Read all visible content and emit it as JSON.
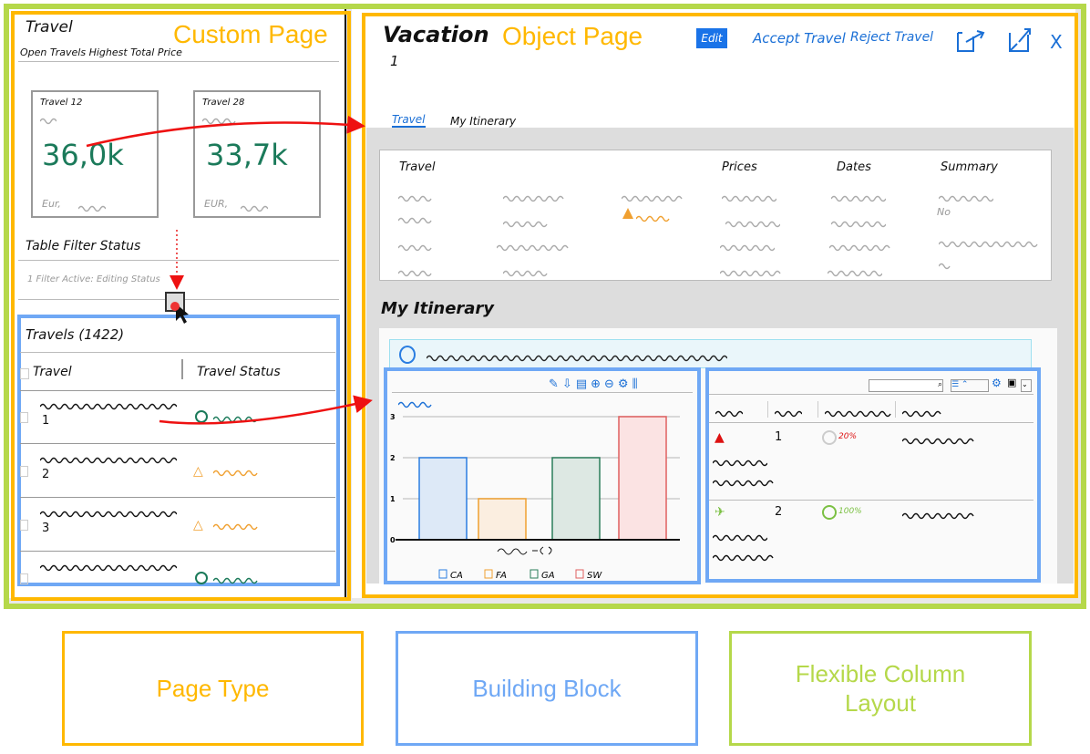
{
  "colors": {
    "page_type": "#ffb800",
    "building_block": "#6fa8f5",
    "flexible_column_layout": "#b5d84a",
    "kpi": "#1b7a5a",
    "action": "#1a6fd6",
    "arrow": "#ee1111"
  },
  "custom_page": {
    "type_label": "Custom Page",
    "title": "Travel",
    "subtitle": "Open Travels Highest Total Price",
    "cards": [
      {
        "title": "Travel 12",
        "value": "36,0k",
        "unit": "Eur,"
      },
      {
        "title": "Travel 28",
        "value": "33,7k",
        "unit": "EUR,"
      }
    ],
    "filter_section_title": "Table Filter Status",
    "filter_text": "1 Filter Active: Editing Status",
    "table": {
      "title": "Travels (1422)",
      "columns": [
        "Travel",
        "Travel Status"
      ],
      "rows": [
        {
          "id": "1",
          "status_icon": "circle-icon",
          "status_color": "#1b7a5a"
        },
        {
          "id": "2",
          "status_icon": "triangle-warning-icon",
          "status_color": "#f0a030"
        },
        {
          "id": "3",
          "status_icon": "triangle-warning-icon",
          "status_color": "#f0a030"
        },
        {
          "id": "",
          "status_icon": "circle-icon",
          "status_color": "#1b7a5a"
        }
      ]
    }
  },
  "object_page": {
    "type_label": "Object Page",
    "title": "Vacation",
    "subtitle": "1",
    "actions": {
      "edit": "Edit",
      "accept": "Accept Travel",
      "reject": "Reject Travel",
      "close": "X"
    },
    "tabs": [
      "Travel",
      "My Itinerary"
    ],
    "facet_headers": [
      "Travel",
      "Prices",
      "Dates",
      "Summary"
    ],
    "summary_value": "No",
    "section_title": "My Itinerary",
    "items_table": {
      "rows": [
        {
          "id": "1",
          "percent": "20%",
          "color": "#d11"
        },
        {
          "id": "2",
          "percent": "100%",
          "color": "#7bc043"
        }
      ]
    }
  },
  "chart_data": {
    "type": "bar",
    "categories": [
      "CA",
      "FA",
      "GA",
      "SW"
    ],
    "values": [
      2,
      1,
      2,
      3
    ],
    "colors": [
      "#2a7de1",
      "#f0a030",
      "#2a7d5a",
      "#e06060"
    ],
    "fills": [
      "#dde9f7",
      "#fbeee0",
      "#dde8e3",
      "#fbe3e3"
    ],
    "yticks": [
      "0",
      "1",
      "2",
      "3"
    ],
    "ylim": [
      0,
      3
    ],
    "grid": true,
    "legend_placement": "bottom"
  },
  "legend": {
    "page_type": "Page Type",
    "building_block": "Building Block",
    "flexible_column_layout": "Flexible Column Layout"
  }
}
